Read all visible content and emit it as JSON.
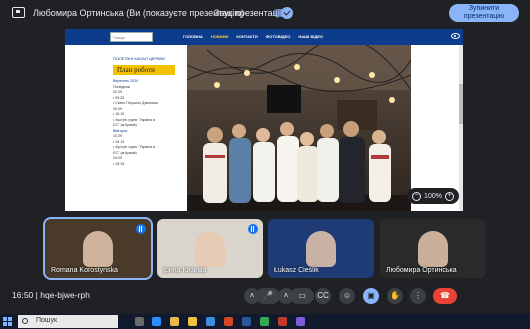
{
  "topbar": {
    "presenter_text": "Любомира Ортинська (Ви (показуєте презентацію)",
    "sound_label": "Звук презентації",
    "sound_toggle_on": true,
    "stop_button": "Зупинити презентацію"
  },
  "shared_screen": {
    "search_placeholder": "Пошук",
    "nav_items": [
      "ГОЛОВНА",
      "НОВИНИ",
      "КОНТАКТИ",
      "ФОТОВІДЕО",
      "НАШІ ВІДЕО"
    ],
    "active_nav_index": 1,
    "logo_text": "ПОЛЕТАНІ КАНАЛ ЦЕРКВИ",
    "plan_title": "План роботи",
    "side_list": [
      {
        "text": "Вересень 2024",
        "header": true
      },
      {
        "text": "Понеділок",
        "header": false
      },
      {
        "text": "02.09",
        "header": false
      },
      {
        "text": "• 09.20",
        "header": false
      },
      {
        "text": "• Свято Першого Дзвоника",
        "header": false
      },
      {
        "text": "09.09",
        "header": false
      },
      {
        "text": "• 15.15",
        "header": false
      },
      {
        "text": "• Зустріч групи \"Україна в",
        "header": false
      },
      {
        "text": "  ЄС\" (м.Краків)",
        "header": false
      },
      {
        "text": "Вівторок",
        "header": true
      },
      {
        "text": "10.09",
        "header": false
      },
      {
        "text": "• 15.15",
        "header": false
      },
      {
        "text": "• Зустріч групи \"Україна в",
        "header": false
      },
      {
        "text": "  ЄС\" (м.Краків)",
        "header": false
      },
      {
        "text": "24.09",
        "header": false
      },
      {
        "text": "• 15.15",
        "header": false
      }
    ],
    "zoom_value": "100%"
  },
  "participants": [
    {
      "name": "Romana Korostynska",
      "speaking": true,
      "bg": "#4a3a2a"
    },
    {
      "name": "Ірина Кизима",
      "speaking": false,
      "bg": "#d9d4cc"
    },
    {
      "name": "Łukasz Cieślik",
      "speaking": false,
      "bg": "#1f3b75"
    },
    {
      "name": "Любомира Ортинська",
      "speaking": false,
      "bg": "#2a2a2a"
    }
  ],
  "bottombar": {
    "time": "16:50",
    "meeting_code": "hqe-bjwe-rph"
  },
  "taskbar": {
    "search_text": "Пошук"
  },
  "colors": {
    "accent": "#8ab4f8",
    "end_call": "#ea4335",
    "site_nav": "#0d3c8c",
    "plan_title_bg": "#f2c200"
  }
}
